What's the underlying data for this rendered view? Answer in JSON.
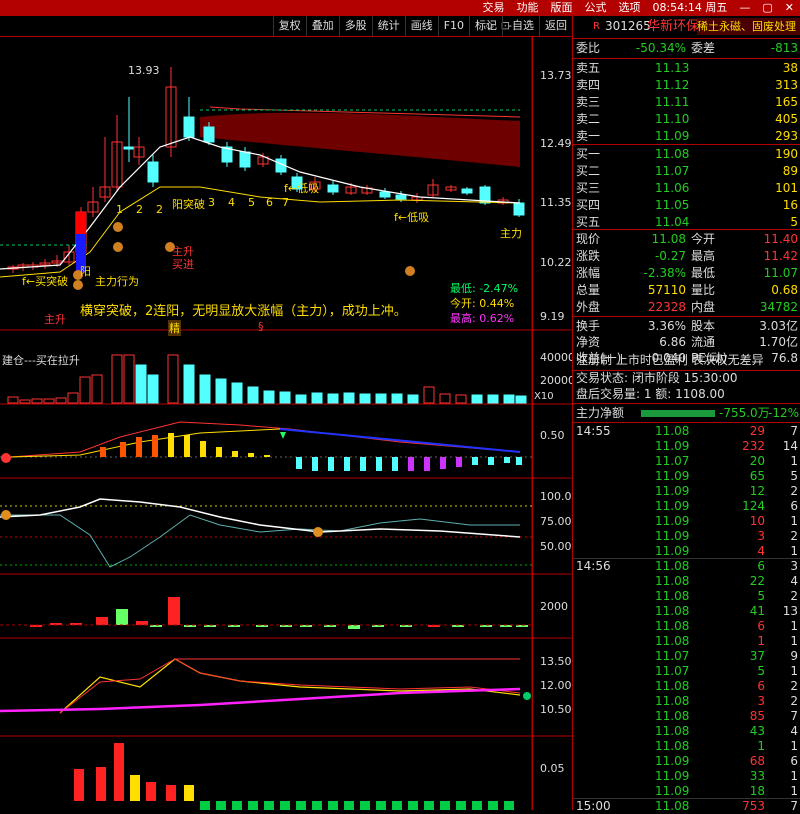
{
  "topbar": {
    "menu": [
      "交易",
      "功能",
      "版面",
      "公式",
      "选项"
    ],
    "time": "08:54:14 周五"
  },
  "toolbar": {
    "buttons": [
      "复权",
      "叠加",
      "多股",
      "统计",
      "画线",
      "F10",
      "标记",
      "-自选",
      "返回"
    ]
  },
  "chart": {
    "main_ticks": [
      "13.73",
      "12.49",
      "11.35",
      "10.22",
      "9.19"
    ],
    "peak_label": "13.93",
    "annotations": {
      "breakthrough_text": "横穿突破，2连阳，无明显放大涨幅（主力），成功上冲。",
      "low_label": "最低: -2.47%",
      "open_label": "今开: 0.44%",
      "high_label": "最高: 0.62%",
      "rise_buy": "主升\n买进",
      "main_behavior": "主力行为",
      "yang": "阳",
      "yang_break": "阳突破",
      "low_absorb1": "f←低吸",
      "low_absorb2": "f←低吸",
      "seq": [
        "1",
        "2",
        "2",
        "3",
        "4",
        "5",
        "6",
        "7"
      ],
      "buy_break": "f←买突破",
      "main_up": "主升",
      "main_right": "主力",
      "jing": "精",
      "s_mark": "§"
    },
    "vol_label": "建仓---买在拉升",
    "vol_ticks": [
      "40000",
      "20000"
    ],
    "vol_unit": "X10",
    "macd_ticks": [
      "0.50"
    ],
    "kdj_ticks": [
      "100.0",
      "75.00",
      "50.00"
    ],
    "p4_ticks": [
      "2000"
    ],
    "p5_ticks": [
      "13.50",
      "12.00",
      "10.50"
    ],
    "p6_ticks": [
      "0.05"
    ]
  },
  "quote": {
    "flag": "R",
    "code": "301265",
    "name": "华新环保",
    "concept": "稀土永磁、固废处理",
    "weibi_label": "委比",
    "weibi": "-50.34%",
    "weicha_label": "委差",
    "weicha": "-813",
    "asks": [
      {
        "label": "卖五",
        "price": "11.13",
        "vol": "38"
      },
      {
        "label": "卖四",
        "price": "11.12",
        "vol": "313"
      },
      {
        "label": "卖三",
        "price": "11.11",
        "vol": "165"
      },
      {
        "label": "卖二",
        "price": "11.10",
        "vol": "405"
      },
      {
        "label": "卖一",
        "price": "11.09",
        "vol": "293"
      }
    ],
    "bids": [
      {
        "label": "买一",
        "price": "11.08",
        "vol": "190"
      },
      {
        "label": "买二",
        "price": "11.07",
        "vol": "89"
      },
      {
        "label": "买三",
        "price": "11.06",
        "vol": "101"
      },
      {
        "label": "买四",
        "price": "11.05",
        "vol": "16"
      },
      {
        "label": "买五",
        "price": "11.04",
        "vol": "5"
      }
    ],
    "stats": [
      {
        "l1": "现价",
        "v1": "11.08",
        "l2": "今开",
        "v2": "11.40",
        "c1": "c-g",
        "c2": "c-r"
      },
      {
        "l1": "涨跌",
        "v1": "-0.27",
        "l2": "最高",
        "v2": "11.42",
        "c1": "c-g",
        "c2": "c-r"
      },
      {
        "l1": "涨幅",
        "v1": "-2.38%",
        "l2": "最低",
        "v2": "11.07",
        "c1": "c-g",
        "c2": "c-g"
      },
      {
        "l1": "总量",
        "v1": "57110",
        "l2": "量比",
        "v2": "0.68",
        "c1": "c-y",
        "c2": "c-y"
      },
      {
        "l1": "外盘",
        "v1": "22328",
        "l2": "内盘",
        "v2": "34782",
        "c1": "c-r",
        "c2": "c-g"
      }
    ],
    "stats2": [
      {
        "l1": "换手",
        "v1": "3.36%",
        "l2": "股本",
        "v2": "3.03亿"
      },
      {
        "l1": "净资",
        "v1": "6.86",
        "l2": "流通",
        "v2": "1.70亿"
      },
      {
        "l1": "收益(一)",
        "v1": "0.040",
        "l2": "PE(动)",
        "v2": "76.8"
      }
    ],
    "note1": "注册制 上市时已盈利 表决权无差异",
    "note2": "交易状态: 闭市阶段 15:30:00",
    "note3": "盘后交易量: 1  额: 1108.00",
    "netflow_label": "主力净额",
    "netflow_value": "-755.0万",
    "netflow_pct": "-12%",
    "ticks": [
      {
        "t": "14:55",
        "p": "11.08",
        "v": "29",
        "n": "7",
        "pc": "c-g",
        "vc": "c-r"
      },
      {
        "t": "",
        "p": "11.09",
        "v": "232",
        "n": "14",
        "pc": "c-g",
        "vc": "c-r"
      },
      {
        "t": "",
        "p": "11.07",
        "v": "20",
        "n": "1",
        "pc": "c-g",
        "vc": "c-g"
      },
      {
        "t": "",
        "p": "11.09",
        "v": "65",
        "n": "5",
        "pc": "c-g",
        "vc": "c-g"
      },
      {
        "t": "",
        "p": "11.09",
        "v": "12",
        "n": "2",
        "pc": "c-g",
        "vc": "c-g"
      },
      {
        "t": "",
        "p": "11.09",
        "v": "124",
        "n": "6",
        "pc": "c-g",
        "vc": "c-g"
      },
      {
        "t": "",
        "p": "11.09",
        "v": "10",
        "n": "1",
        "pc": "c-g",
        "vc": "c-r"
      },
      {
        "t": "",
        "p": "11.09",
        "v": "3",
        "n": "2",
        "pc": "c-g",
        "vc": "c-r"
      },
      {
        "t": "",
        "p": "11.09",
        "v": "4",
        "n": "1",
        "pc": "c-g",
        "vc": "c-r"
      },
      {
        "t": "14:56",
        "p": "11.08",
        "v": "6",
        "n": "3",
        "pc": "c-g",
        "vc": "c-g"
      },
      {
        "t": "",
        "p": "11.08",
        "v": "22",
        "n": "4",
        "pc": "c-g",
        "vc": "c-g"
      },
      {
        "t": "",
        "p": "11.08",
        "v": "5",
        "n": "2",
        "pc": "c-g",
        "vc": "c-g"
      },
      {
        "t": "",
        "p": "11.08",
        "v": "41",
        "n": "13",
        "pc": "c-g",
        "vc": "c-g"
      },
      {
        "t": "",
        "p": "11.08",
        "v": "6",
        "n": "1",
        "pc": "c-g",
        "vc": "c-r"
      },
      {
        "t": "",
        "p": "11.08",
        "v": "1",
        "n": "1",
        "pc": "c-g",
        "vc": "c-r"
      },
      {
        "t": "",
        "p": "11.07",
        "v": "37",
        "n": "9",
        "pc": "c-g",
        "vc": "c-g"
      },
      {
        "t": "",
        "p": "11.07",
        "v": "5",
        "n": "1",
        "pc": "c-g",
        "vc": "c-g"
      },
      {
        "t": "",
        "p": "11.08",
        "v": "6",
        "n": "2",
        "pc": "c-g",
        "vc": "c-r"
      },
      {
        "t": "",
        "p": "11.08",
        "v": "3",
        "n": "2",
        "pc": "c-g",
        "vc": "c-r"
      },
      {
        "t": "",
        "p": "11.08",
        "v": "85",
        "n": "7",
        "pc": "c-g",
        "vc": "c-r"
      },
      {
        "t": "",
        "p": "11.08",
        "v": "43",
        "n": "4",
        "pc": "c-g",
        "vc": "c-g"
      },
      {
        "t": "",
        "p": "11.08",
        "v": "1",
        "n": "1",
        "pc": "c-g",
        "vc": "c-g"
      },
      {
        "t": "",
        "p": "11.09",
        "v": "68",
        "n": "6",
        "pc": "c-g",
        "vc": "c-r"
      },
      {
        "t": "",
        "p": "11.09",
        "v": "33",
        "n": "1",
        "pc": "c-g",
        "vc": "c-g"
      },
      {
        "t": "",
        "p": "11.09",
        "v": "18",
        "n": "1",
        "pc": "c-g",
        "vc": "c-g"
      },
      {
        "t": "15:00",
        "p": "11.08",
        "v": "753",
        "n": "7",
        "pc": "c-g",
        "vc": "c-r"
      }
    ]
  },
  "colors": {
    "up": "#ff3333",
    "down": "#54ffff",
    "brand": "#b30000",
    "yellow": "#ffde00"
  }
}
